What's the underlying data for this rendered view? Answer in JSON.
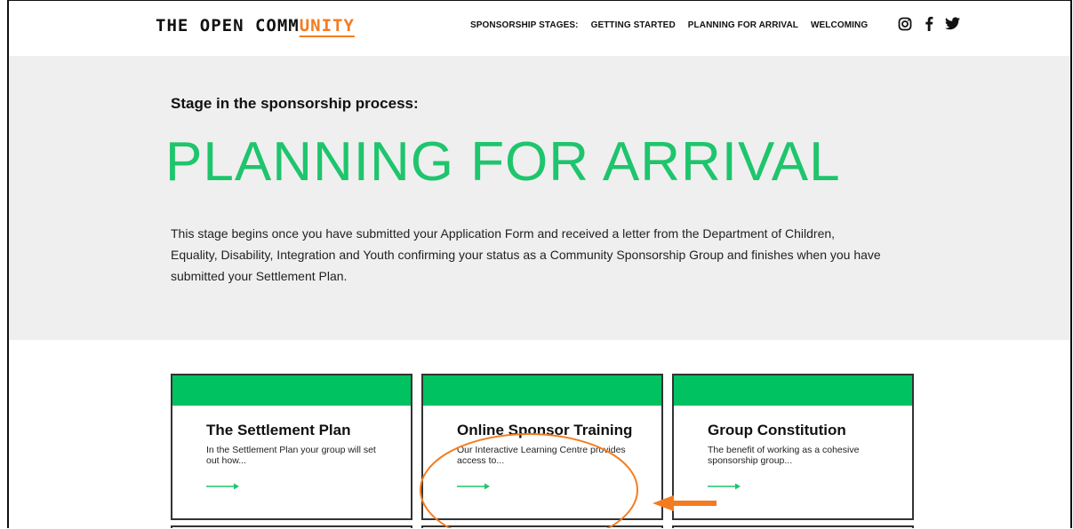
{
  "header": {
    "logo_prefix": "THE OPEN COMM",
    "logo_accent": "UNITY",
    "nav_label": "SPONSORSHIP STAGES:",
    "nav_items": [
      "GETTING STARTED",
      "PLANNING FOR ARRIVAL",
      "WELCOMING"
    ],
    "socials": [
      "instagram-icon",
      "facebook-icon",
      "twitter-icon"
    ]
  },
  "hero": {
    "eyebrow": "Stage in the sponsorship process:",
    "title": "PLANNING FOR ARRIVAL",
    "description": "This stage begins once you have submitted your Application Form and received a letter from the Department of Children, Equality, Disability, Integration and Youth confirming your status as a Community Sponsorship Group and finishes when you have submitted your Settlement Plan."
  },
  "cards": [
    {
      "title": "The Settlement Plan",
      "description": "In the Settlement Plan your group will set out how..."
    },
    {
      "title": "Online Sponsor Training",
      "description": "Our Interactive Learning Centre provides access to..."
    },
    {
      "title": "Group Constitution",
      "description": "The benefit of working as a cohesive sponsorship group..."
    }
  ],
  "colors": {
    "accent_green": "#1ec56c",
    "card_band": "#00c260",
    "annotation_orange": "#f47c20",
    "hero_bg": "#efefef"
  }
}
